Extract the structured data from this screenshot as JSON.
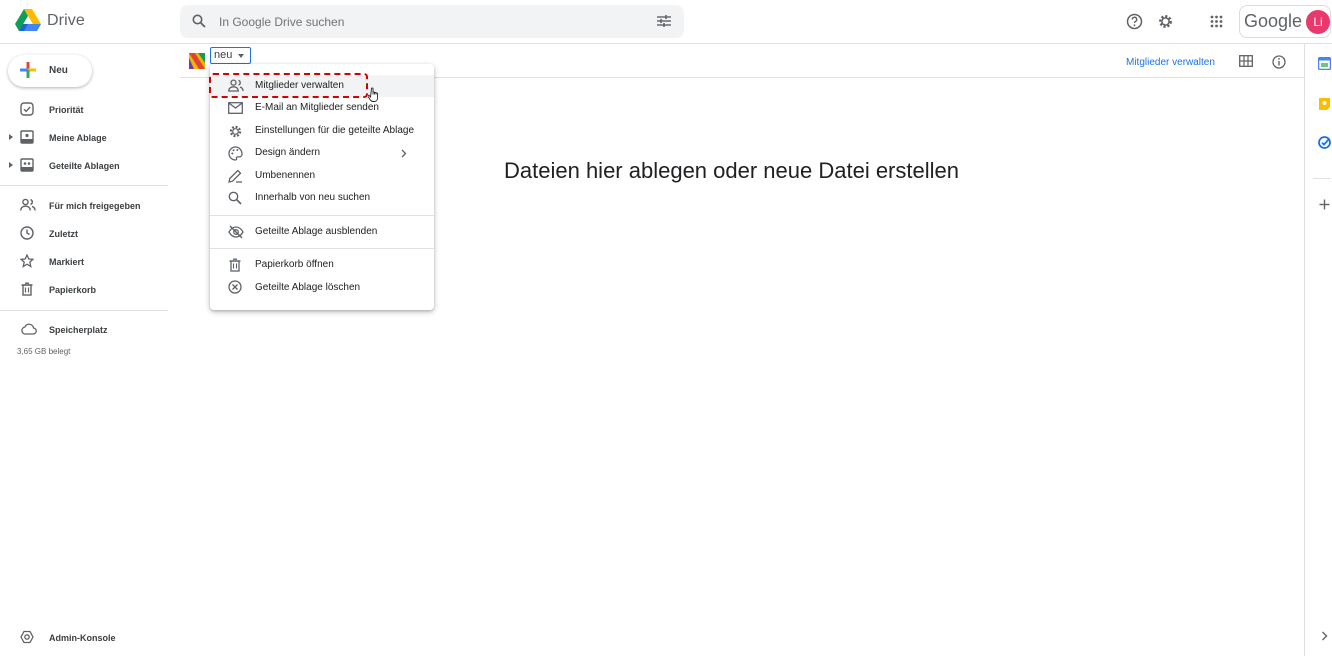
{
  "header": {
    "brand": "Drive",
    "search_placeholder": "In Google Drive suchen",
    "google_word": "Google",
    "avatar_initials": "Li"
  },
  "sidebar": {
    "new_label": "Neu",
    "items": [
      {
        "label": "Priorität",
        "icon": "priority-icon"
      },
      {
        "label": "Meine Ablage",
        "icon": "my-drive-icon"
      },
      {
        "label": "Geteilte Ablagen",
        "icon": "shared-drives-icon"
      },
      {
        "label": "Für mich freigegeben",
        "icon": "people-icon"
      },
      {
        "label": "Zuletzt",
        "icon": "clock-icon"
      },
      {
        "label": "Markiert",
        "icon": "star-icon"
      },
      {
        "label": "Papierkorb",
        "icon": "trash-icon"
      },
      {
        "label": "Speicherplatz",
        "icon": "cloud-icon"
      }
    ],
    "storage_used": "3,65 GB belegt",
    "admin_label": "Admin-Konsole"
  },
  "main": {
    "breadcrumb_label": "neu",
    "manage_members_link": "Mitglieder verwalten",
    "empty_message": "Dateien hier ablegen oder neue Datei erstellen"
  },
  "context_menu": {
    "items": [
      {
        "label": "Mitglieder verwalten",
        "icon": "manage-members-icon"
      },
      {
        "label": "E-Mail an Mitglieder senden",
        "icon": "mail-icon"
      },
      {
        "label": "Einstellungen für die geteilte Ablage",
        "icon": "settings-icon"
      },
      {
        "label": "Design ändern",
        "icon": "palette-icon"
      },
      {
        "label": "Umbenennen",
        "icon": "pencil-icon"
      },
      {
        "label": "Innerhalb von neu suchen",
        "icon": "search-icon"
      },
      {
        "label": "Geteilte Ablage ausblenden",
        "icon": "hide-icon"
      },
      {
        "label": "Papierkorb öffnen",
        "icon": "trash-icon"
      },
      {
        "label": "Geteilte Ablage löschen",
        "icon": "delete-circle-icon"
      }
    ]
  },
  "colors": {
    "accent": "#1a73e8",
    "highlight": "#d50000",
    "avatar": "#e8386e"
  }
}
